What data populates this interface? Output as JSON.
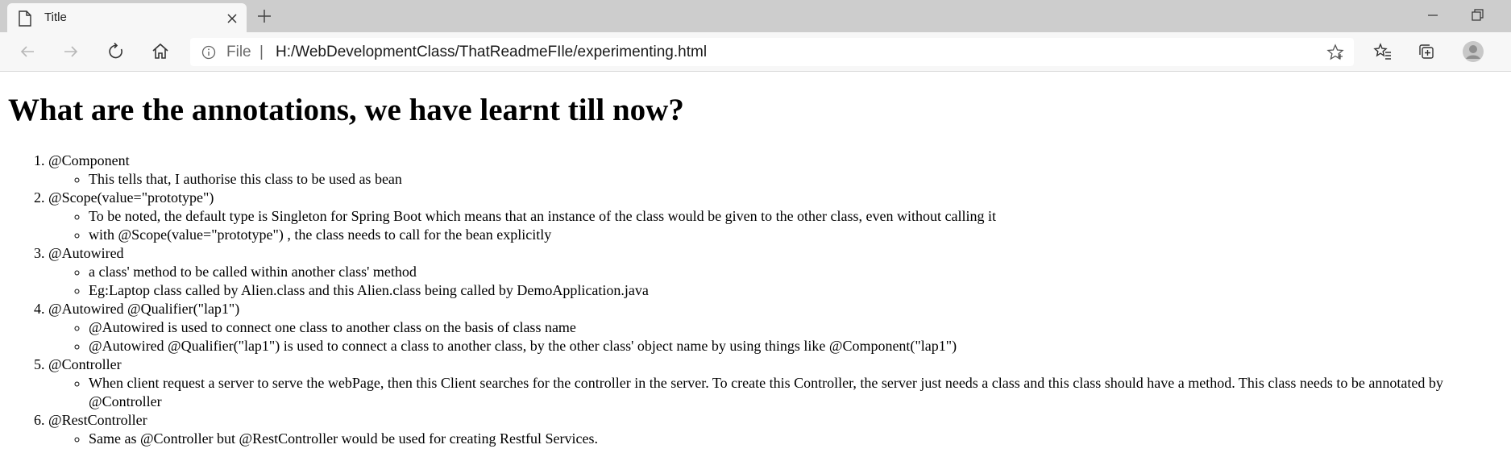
{
  "browser": {
    "tab": {
      "title": "Title",
      "page_icon": "page-icon",
      "close_icon": "close-icon"
    },
    "new_tab_icon": "plus-icon",
    "window_controls": [
      "minimize-icon",
      "restore-icon"
    ],
    "toolbar": {
      "icons": [
        "back-icon",
        "forward-icon",
        "refresh-icon",
        "home-icon"
      ],
      "address": {
        "scheme": "File",
        "separator": "|",
        "url": "H:/WebDevelopmentClass/ThatReadmeFIle/experimenting.html"
      },
      "right_icons": [
        "favorite-star-icon",
        "favorites-icon",
        "collections-icon",
        "profile-icon"
      ]
    }
  },
  "page": {
    "heading": "What are the annotations, we have learnt till now?",
    "items": [
      {
        "title": "@Component",
        "details": [
          "This tells that, I authorise this class to be used as bean"
        ]
      },
      {
        "title": "@Scope(value=\"prototype\")",
        "details": [
          "To be noted, the default type is Singleton for Spring Boot which means that an instance of the class would be given to the other class, even without calling it",
          "with @Scope(value=\"prototype\") , the class needs to call for the bean explicitly"
        ]
      },
      {
        "title": "@Autowired",
        "details": [
          "a class' method to be called within another class' method",
          "Eg:Laptop class called by Alien.class and this Alien.class being called by DemoApplication.java"
        ]
      },
      {
        "title": "@Autowired @Qualifier(\"lap1\")",
        "details": [
          "@Autowired is used to connect one class to another class on the basis of class name",
          "@Autowired @Qualifier(\"lap1\") is used to connect a class to another class, by the other class' object name by using things like @Component(\"lap1\")"
        ]
      },
      {
        "title": "@Controller",
        "details": [
          "When client request a server to serve the webPage, then this Client searches for the controller in the server. To create this Controller, the server just needs a class and this class should have a method. This class needs to be annotated by @Controller"
        ]
      },
      {
        "title": "@RestController",
        "details": [
          "Same as @Controller but @RestController would be used for creating Restful Services."
        ]
      }
    ]
  }
}
